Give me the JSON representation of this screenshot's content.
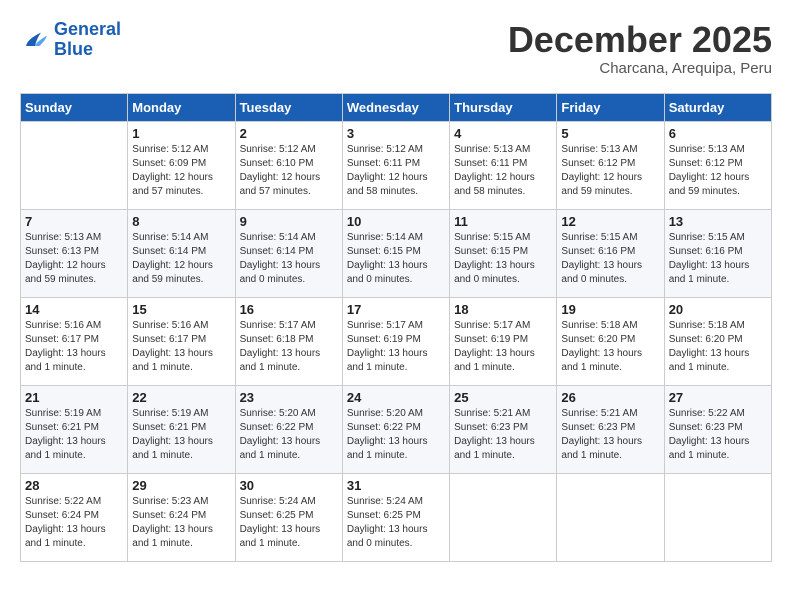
{
  "logo": {
    "line1": "General",
    "line2": "Blue"
  },
  "title": "December 2025",
  "subtitle": "Charcana, Arequipa, Peru",
  "weekdays": [
    "Sunday",
    "Monday",
    "Tuesday",
    "Wednesday",
    "Thursday",
    "Friday",
    "Saturday"
  ],
  "weeks": [
    [
      {
        "day": "",
        "sunrise": "",
        "sunset": "",
        "daylight": ""
      },
      {
        "day": "1",
        "sunrise": "Sunrise: 5:12 AM",
        "sunset": "Sunset: 6:09 PM",
        "daylight": "Daylight: 12 hours and 57 minutes."
      },
      {
        "day": "2",
        "sunrise": "Sunrise: 5:12 AM",
        "sunset": "Sunset: 6:10 PM",
        "daylight": "Daylight: 12 hours and 57 minutes."
      },
      {
        "day": "3",
        "sunrise": "Sunrise: 5:12 AM",
        "sunset": "Sunset: 6:11 PM",
        "daylight": "Daylight: 12 hours and 58 minutes."
      },
      {
        "day": "4",
        "sunrise": "Sunrise: 5:13 AM",
        "sunset": "Sunset: 6:11 PM",
        "daylight": "Daylight: 12 hours and 58 minutes."
      },
      {
        "day": "5",
        "sunrise": "Sunrise: 5:13 AM",
        "sunset": "Sunset: 6:12 PM",
        "daylight": "Daylight: 12 hours and 59 minutes."
      },
      {
        "day": "6",
        "sunrise": "Sunrise: 5:13 AM",
        "sunset": "Sunset: 6:12 PM",
        "daylight": "Daylight: 12 hours and 59 minutes."
      }
    ],
    [
      {
        "day": "7",
        "sunrise": "Sunrise: 5:13 AM",
        "sunset": "Sunset: 6:13 PM",
        "daylight": "Daylight: 12 hours and 59 minutes."
      },
      {
        "day": "8",
        "sunrise": "Sunrise: 5:14 AM",
        "sunset": "Sunset: 6:14 PM",
        "daylight": "Daylight: 12 hours and 59 minutes."
      },
      {
        "day": "9",
        "sunrise": "Sunrise: 5:14 AM",
        "sunset": "Sunset: 6:14 PM",
        "daylight": "Daylight: 13 hours and 0 minutes."
      },
      {
        "day": "10",
        "sunrise": "Sunrise: 5:14 AM",
        "sunset": "Sunset: 6:15 PM",
        "daylight": "Daylight: 13 hours and 0 minutes."
      },
      {
        "day": "11",
        "sunrise": "Sunrise: 5:15 AM",
        "sunset": "Sunset: 6:15 PM",
        "daylight": "Daylight: 13 hours and 0 minutes."
      },
      {
        "day": "12",
        "sunrise": "Sunrise: 5:15 AM",
        "sunset": "Sunset: 6:16 PM",
        "daylight": "Daylight: 13 hours and 0 minutes."
      },
      {
        "day": "13",
        "sunrise": "Sunrise: 5:15 AM",
        "sunset": "Sunset: 6:16 PM",
        "daylight": "Daylight: 13 hours and 1 minute."
      }
    ],
    [
      {
        "day": "14",
        "sunrise": "Sunrise: 5:16 AM",
        "sunset": "Sunset: 6:17 PM",
        "daylight": "Daylight: 13 hours and 1 minute."
      },
      {
        "day": "15",
        "sunrise": "Sunrise: 5:16 AM",
        "sunset": "Sunset: 6:17 PM",
        "daylight": "Daylight: 13 hours and 1 minute."
      },
      {
        "day": "16",
        "sunrise": "Sunrise: 5:17 AM",
        "sunset": "Sunset: 6:18 PM",
        "daylight": "Daylight: 13 hours and 1 minute."
      },
      {
        "day": "17",
        "sunrise": "Sunrise: 5:17 AM",
        "sunset": "Sunset: 6:19 PM",
        "daylight": "Daylight: 13 hours and 1 minute."
      },
      {
        "day": "18",
        "sunrise": "Sunrise: 5:17 AM",
        "sunset": "Sunset: 6:19 PM",
        "daylight": "Daylight: 13 hours and 1 minute."
      },
      {
        "day": "19",
        "sunrise": "Sunrise: 5:18 AM",
        "sunset": "Sunset: 6:20 PM",
        "daylight": "Daylight: 13 hours and 1 minute."
      },
      {
        "day": "20",
        "sunrise": "Sunrise: 5:18 AM",
        "sunset": "Sunset: 6:20 PM",
        "daylight": "Daylight: 13 hours and 1 minute."
      }
    ],
    [
      {
        "day": "21",
        "sunrise": "Sunrise: 5:19 AM",
        "sunset": "Sunset: 6:21 PM",
        "daylight": "Daylight: 13 hours and 1 minute."
      },
      {
        "day": "22",
        "sunrise": "Sunrise: 5:19 AM",
        "sunset": "Sunset: 6:21 PM",
        "daylight": "Daylight: 13 hours and 1 minute."
      },
      {
        "day": "23",
        "sunrise": "Sunrise: 5:20 AM",
        "sunset": "Sunset: 6:22 PM",
        "daylight": "Daylight: 13 hours and 1 minute."
      },
      {
        "day": "24",
        "sunrise": "Sunrise: 5:20 AM",
        "sunset": "Sunset: 6:22 PM",
        "daylight": "Daylight: 13 hours and 1 minute."
      },
      {
        "day": "25",
        "sunrise": "Sunrise: 5:21 AM",
        "sunset": "Sunset: 6:23 PM",
        "daylight": "Daylight: 13 hours and 1 minute."
      },
      {
        "day": "26",
        "sunrise": "Sunrise: 5:21 AM",
        "sunset": "Sunset: 6:23 PM",
        "daylight": "Daylight: 13 hours and 1 minute."
      },
      {
        "day": "27",
        "sunrise": "Sunrise: 5:22 AM",
        "sunset": "Sunset: 6:23 PM",
        "daylight": "Daylight: 13 hours and 1 minute."
      }
    ],
    [
      {
        "day": "28",
        "sunrise": "Sunrise: 5:22 AM",
        "sunset": "Sunset: 6:24 PM",
        "daylight": "Daylight: 13 hours and 1 minute."
      },
      {
        "day": "29",
        "sunrise": "Sunrise: 5:23 AM",
        "sunset": "Sunset: 6:24 PM",
        "daylight": "Daylight: 13 hours and 1 minute."
      },
      {
        "day": "30",
        "sunrise": "Sunrise: 5:24 AM",
        "sunset": "Sunset: 6:25 PM",
        "daylight": "Daylight: 13 hours and 1 minute."
      },
      {
        "day": "31",
        "sunrise": "Sunrise: 5:24 AM",
        "sunset": "Sunset: 6:25 PM",
        "daylight": "Daylight: 13 hours and 0 minutes."
      },
      {
        "day": "",
        "sunrise": "",
        "sunset": "",
        "daylight": ""
      },
      {
        "day": "",
        "sunrise": "",
        "sunset": "",
        "daylight": ""
      },
      {
        "day": "",
        "sunrise": "",
        "sunset": "",
        "daylight": ""
      }
    ]
  ]
}
